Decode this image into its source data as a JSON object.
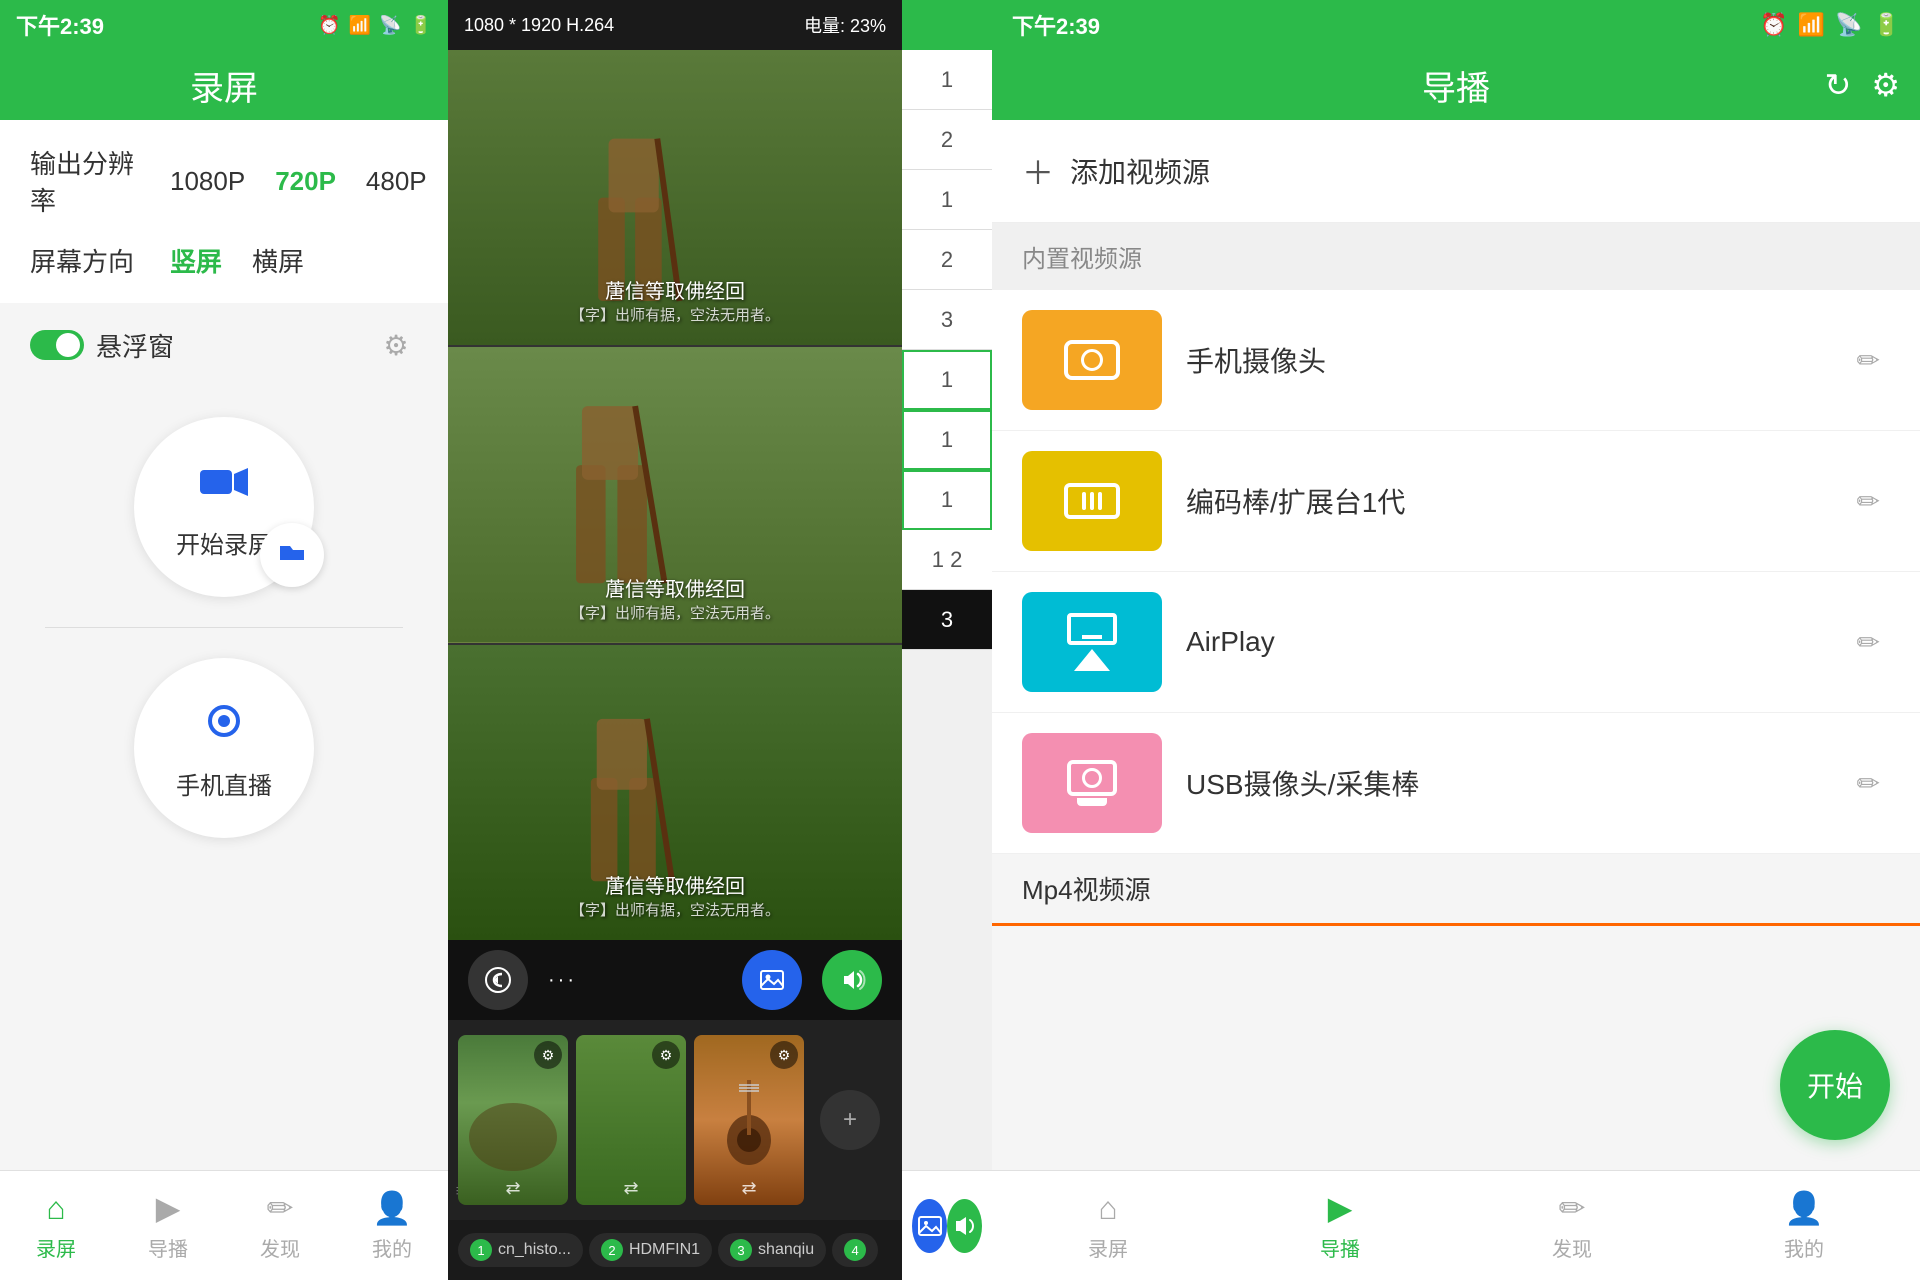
{
  "panel_luping": {
    "status_bar": {
      "time": "下午2:39"
    },
    "header": {
      "title": "录屏"
    },
    "settings": {
      "resolution_label": "输出分辨率",
      "resolution_options": [
        "1080P",
        "720P",
        "480P"
      ],
      "resolution_active": "720P",
      "orientation_label": "屏幕方向",
      "orientation_options": [
        "竖屏",
        "横屏"
      ],
      "orientation_active": "竖屏"
    },
    "floating_window": {
      "label": "悬浮窗"
    },
    "record_btn": {
      "label": "开始录屏"
    },
    "phone_live_btn": {
      "label": "手机直播"
    },
    "bottom_nav": [
      {
        "label": "录屏",
        "active": true
      },
      {
        "label": "导播",
        "active": false
      },
      {
        "label": "发现",
        "active": false
      },
      {
        "label": "我的",
        "active": false
      }
    ]
  },
  "panel_editor": {
    "top_bar": {
      "resolution": "1080 * 1920  H.264",
      "battery": "电量: 23%"
    },
    "video_caption": "蓎信等取佛经回",
    "video_sub": "【字】出师有据，空法无用者。",
    "ctrl_icons": [
      "回退",
      "更多",
      "图片",
      "声音"
    ],
    "tabs": [
      {
        "num": "1",
        "label": "cn_histo..."
      },
      {
        "num": "2",
        "label": "HDMFIN1"
      },
      {
        "num": "3",
        "label": "shanqiu"
      },
      {
        "num": "4",
        "label": ""
      }
    ]
  },
  "panel_timeline": {
    "cells": [
      {
        "value": "1"
      },
      {
        "value": "2"
      },
      {
        "value": "1"
      },
      {
        "value": "2"
      },
      {
        "value": "3"
      },
      {
        "value": "1",
        "selected": true
      },
      {
        "value": "1"
      },
      {
        "value": "1"
      },
      {
        "value": "1",
        "selected": true
      },
      {
        "value": "2"
      },
      {
        "value": "3"
      }
    ]
  },
  "panel_daobo": {
    "status_bar": {
      "time": "下午2:39"
    },
    "header": {
      "title": "导播",
      "refresh_icon": "↻",
      "settings_icon": "⚙"
    },
    "add_source": {
      "label": "添加视频源"
    },
    "builtin_section": {
      "label": "内置视频源"
    },
    "sources": [
      {
        "name": "手机摄像头",
        "color": "orange",
        "icon_type": "camera"
      },
      {
        "name": "编码棒/扩展台1代",
        "color": "yellow",
        "icon_type": "encoder"
      },
      {
        "name": "AirPlay",
        "color": "teal",
        "icon_type": "airplay"
      },
      {
        "name": "USB摄像头/采集棒",
        "color": "pink",
        "icon_type": "usbcam"
      }
    ],
    "mp4_section": {
      "label": "Mp4视频源"
    },
    "start_btn": "开始",
    "bottom_nav": [
      {
        "label": "录屏",
        "active": false
      },
      {
        "label": "导播",
        "active": true
      },
      {
        "label": "发现",
        "active": false
      },
      {
        "label": "我的",
        "active": false
      }
    ]
  }
}
